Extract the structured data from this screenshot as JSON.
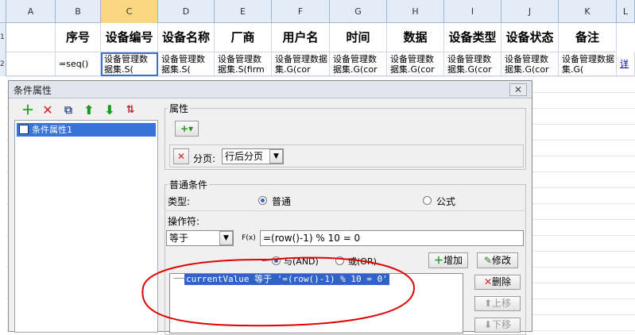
{
  "columns": [
    "A",
    "B",
    "C",
    "D",
    "E",
    "F",
    "G",
    "H",
    "I",
    "J",
    "K",
    "L"
  ],
  "row_numbers": [
    "1",
    "2"
  ],
  "header_row": [
    "",
    "序号",
    "设备编号",
    "设备名称",
    "厂商",
    "用户名",
    "时间",
    "数据",
    "设备类型",
    "设备状态",
    "备注"
  ],
  "data_row": [
    "",
    "=seq()",
    "设备管理数据集.S(",
    "设备管理数据集.S(",
    "设备管理数据集.S(firm",
    "设备管理数据集.G(cor",
    "设备管理数据集.G(cor",
    "设备管理数据集.G(cor",
    "设备管理数据集.G(cor",
    "设备管理数据集.G(cor",
    "设备管理数据集.G(",
    "详"
  ],
  "dialog": {
    "title": "条件属性",
    "close": "✕",
    "tree_item": "条件属性1",
    "props_label": "属性",
    "add_dropdown": "+▾",
    "paging_label": "分页:",
    "paging_value": "行后分页",
    "common_group": "普通条件",
    "type_label": "类型:",
    "type_normal": "普通",
    "type_formula": "公式",
    "operator_label": "操作符:",
    "operator_value": "等于",
    "fx_label": "F(x)",
    "formula_value": "=(row()-1) % 10 = 0",
    "and_label": "与(AND)",
    "or_label": "或(OR)",
    "add_label": "增加",
    "edit_label": "修改",
    "delete_label": "删除",
    "move_up_label": "上移",
    "move_down_label": "下移",
    "condition_item": "currentValue 等于 '=(row()-1) % 10 = 0'"
  },
  "colors": {
    "accent": "#3874d8",
    "annotation": "#e00000"
  }
}
